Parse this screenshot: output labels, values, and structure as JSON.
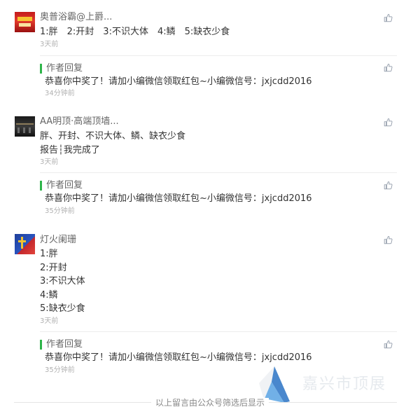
{
  "comments": [
    {
      "nickname": "奥普浴霸@上爵...",
      "lines": [
        "1:胖　2:开封　3:不识大体　4:鳞　5:缺衣少食"
      ],
      "time": "3天前",
      "reply": {
        "label": "作者回复",
        "text": "恭喜你中奖了！请加小编微信领取红包~小编微信号：jxjcdd2016",
        "time": "34分钟前"
      }
    },
    {
      "nickname": "AA明顶·高端顶墙...",
      "lines": [
        "胖、开封、不识大体、鳞、缺衣少食",
        "报告┆我完成了"
      ],
      "time": "3天前",
      "reply": {
        "label": "作者回复",
        "text": "恭喜你中奖了！请加小编微信领取红包~小编微信号：jxjcdd2016",
        "time": "35分钟前"
      }
    },
    {
      "nickname": "灯火阑珊",
      "lines": [
        "1:胖",
        "2:开封",
        "3:不识大体",
        "4:鳞",
        "5:缺衣少食"
      ],
      "time": "3天前",
      "reply": {
        "label": "作者回复",
        "text": "恭喜你中奖了！请加小编微信领取红包~小编微信号：jxjcdd2016",
        "time": "35分钟前"
      }
    }
  ],
  "footer": "以上留言由公众号筛选后显示",
  "watermark": "嘉兴市顶展",
  "colors": {
    "accent": "#2fb54a",
    "like_icon": "#9aa3b0",
    "time": "#b2b2b2"
  },
  "icons": {
    "like": "thumbs-up-icon"
  }
}
